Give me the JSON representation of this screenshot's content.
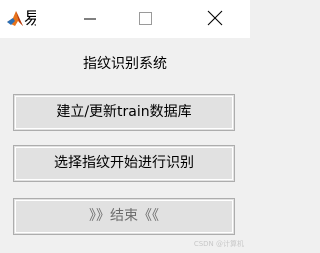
{
  "window": {
    "title": "易"
  },
  "form": {
    "title": "指纹识别系统",
    "buttons": {
      "build_label": "建立/更新train数据库",
      "recognize_label": "选择指纹开始进行识别",
      "exit_label": "》》结束《《"
    }
  },
  "watermark": "CSDN @计算机"
}
